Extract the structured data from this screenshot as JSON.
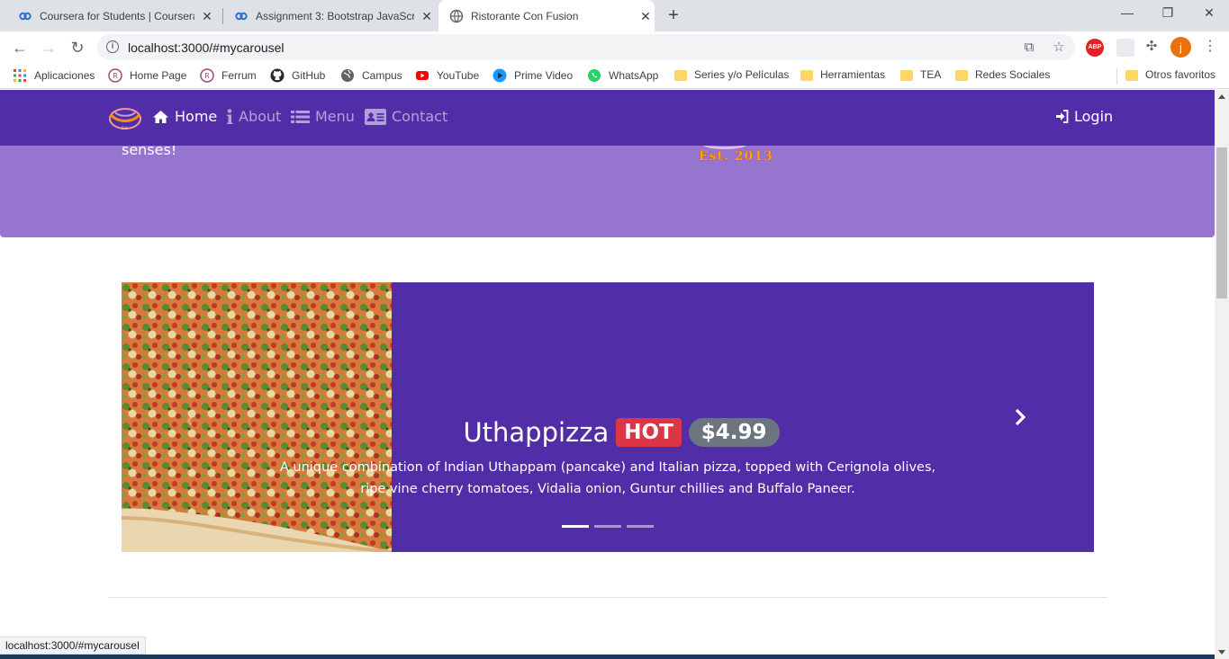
{
  "browser": {
    "tabs": [
      {
        "title": "Coursera for Students | Coursera",
        "favicon": "coursera-icon",
        "active": false
      },
      {
        "title": "Assignment 3: Bootstrap JavaScri",
        "favicon": "coursera-icon",
        "active": false
      },
      {
        "title": "Ristorante Con Fusion",
        "favicon": "globe-icon",
        "active": true
      }
    ],
    "url": "localhost:3000/#mycarousel",
    "bookmarks": [
      {
        "label": "Aplicaciones",
        "icon": "apps-grid-icon"
      },
      {
        "label": "Home Page",
        "icon": "site-icon"
      },
      {
        "label": "Ferrum",
        "icon": "site-icon"
      },
      {
        "label": "GitHub",
        "icon": "github-icon"
      },
      {
        "label": "Campus",
        "icon": "globe-icon"
      },
      {
        "label": "YouTube",
        "icon": "youtube-icon"
      },
      {
        "label": "Prime Video",
        "icon": "prime-video-icon"
      },
      {
        "label": "WhatsApp",
        "icon": "whatsapp-icon"
      },
      {
        "label": "Series y/o Películas",
        "icon": "folder-icon"
      },
      {
        "label": "Herramientas",
        "icon": "folder-icon"
      },
      {
        "label": "TEA",
        "icon": "folder-icon"
      },
      {
        "label": "Redes Sociales",
        "icon": "folder-icon"
      }
    ],
    "other_bookmarks": "Otros favoritos",
    "avatar_letter": "j",
    "status_url": "localhost:3000/#mycarousel"
  },
  "navbar": {
    "items": [
      {
        "label": "Home",
        "icon": "home-icon",
        "active": true
      },
      {
        "label": "About",
        "icon": "info-icon",
        "active": false
      },
      {
        "label": "Menu",
        "icon": "list-icon",
        "active": false
      },
      {
        "label": "Contact",
        "icon": "address-card-icon",
        "active": false
      }
    ],
    "login": "Login"
  },
  "jumbotron": {
    "tagline_tail": "senses!",
    "logo_text": "Est. 2013"
  },
  "carousel": {
    "title": "Uthappizza",
    "badge": "HOT",
    "price": "$4.99",
    "description": "A unique combination of Indian Uthappam (pancake) and Italian pizza, topped with Cerignola olives, ripe vine cherry tomatoes, Vidalia onion, Guntur chillies and Buffalo Paneer.",
    "active_slide": 0,
    "slide_count": 3
  },
  "colors": {
    "primary": "#512da8",
    "light_primary": "#9575cd",
    "hot_badge": "#dc3545",
    "price_badge": "#6c757d"
  }
}
